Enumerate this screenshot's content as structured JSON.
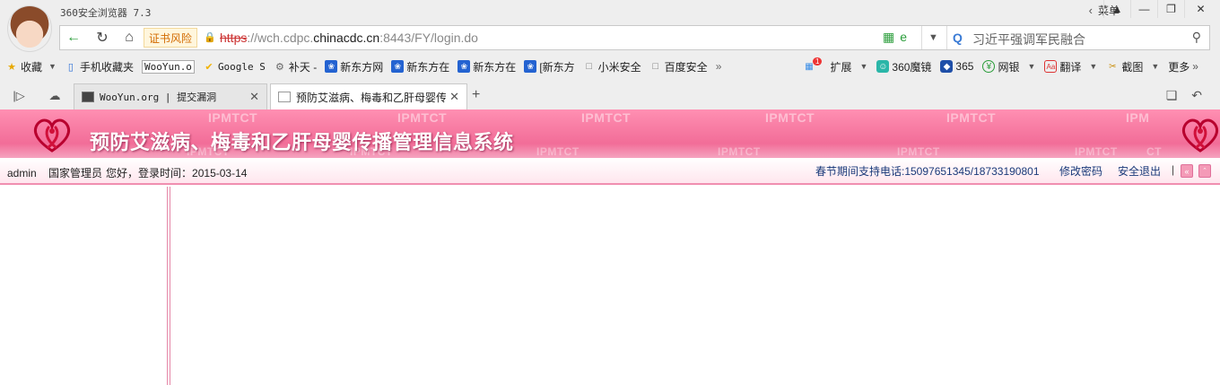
{
  "window": {
    "title": "360安全浏览器 7.3",
    "menu_label": "菜单"
  },
  "navbar": {
    "cert_warning": "证书风险",
    "url_protocol": "https",
    "url_prefix": "://wch.cdpc.",
    "url_host": "chinacdc.cn",
    "url_suffix": ":8443/FY/login.do",
    "search_text": "习近平强调军民融合"
  },
  "bookmarks": [
    {
      "label": "收藏",
      "icon": "star-add-icon"
    },
    {
      "label": "手机收藏夹",
      "icon": "phone-icon"
    },
    {
      "label": "WooYun.o",
      "icon": "wooyun-icon"
    },
    {
      "label": "Google S",
      "icon": "google-icon"
    },
    {
      "label": "补天 -",
      "icon": "butian-icon"
    },
    {
      "label": "新东方网",
      "icon": "baidu-paw-icon"
    },
    {
      "label": "新东方在",
      "icon": "baidu-paw-icon"
    },
    {
      "label": "新东方在",
      "icon": "baidu-paw-icon"
    },
    {
      "label": "[新东方",
      "icon": "baidu-paw-icon"
    },
    {
      "label": "小米安全",
      "icon": "page-icon"
    },
    {
      "label": "百度安全",
      "icon": "page-icon"
    }
  ],
  "tools": [
    {
      "label": "扩展",
      "icon": "extensions-icon",
      "badge": "1"
    },
    {
      "label": "360魔镜",
      "icon": "mirror-icon"
    },
    {
      "label": "365",
      "icon": "shield-icon"
    },
    {
      "label": "网银",
      "icon": "bank-icon"
    },
    {
      "label": "翻译",
      "icon": "translate-icon"
    },
    {
      "label": "截图",
      "icon": "screenshot-icon"
    },
    {
      "label": "更多",
      "icon": "more-icon"
    }
  ],
  "tabs": [
    {
      "label": "WooYun.org | 提交漏洞"
    },
    {
      "label": "预防艾滋病、梅毒和乙肝母婴传"
    }
  ],
  "page": {
    "watermark": "IPMTCT",
    "watermark_partial_1": "IPM",
    "watermark_partial_2": "CT",
    "system_title": "预防艾滋病、梅毒和乙肝母婴传播管理信息系统",
    "user_name": "admin",
    "user_role": "国家管理员",
    "greeting": "您好，登录时间：2015-03-14",
    "support_phone": "春节期间支持电话:15097651345/18733190801",
    "change_password": "修改密码",
    "logout": "安全退出",
    "separator": "|"
  },
  "colors": {
    "banner_pink": "#f26d98",
    "accent_pink": "#e58aa9",
    "link_blue": "#1a3a7a",
    "cert_orange": "#d26a00"
  }
}
